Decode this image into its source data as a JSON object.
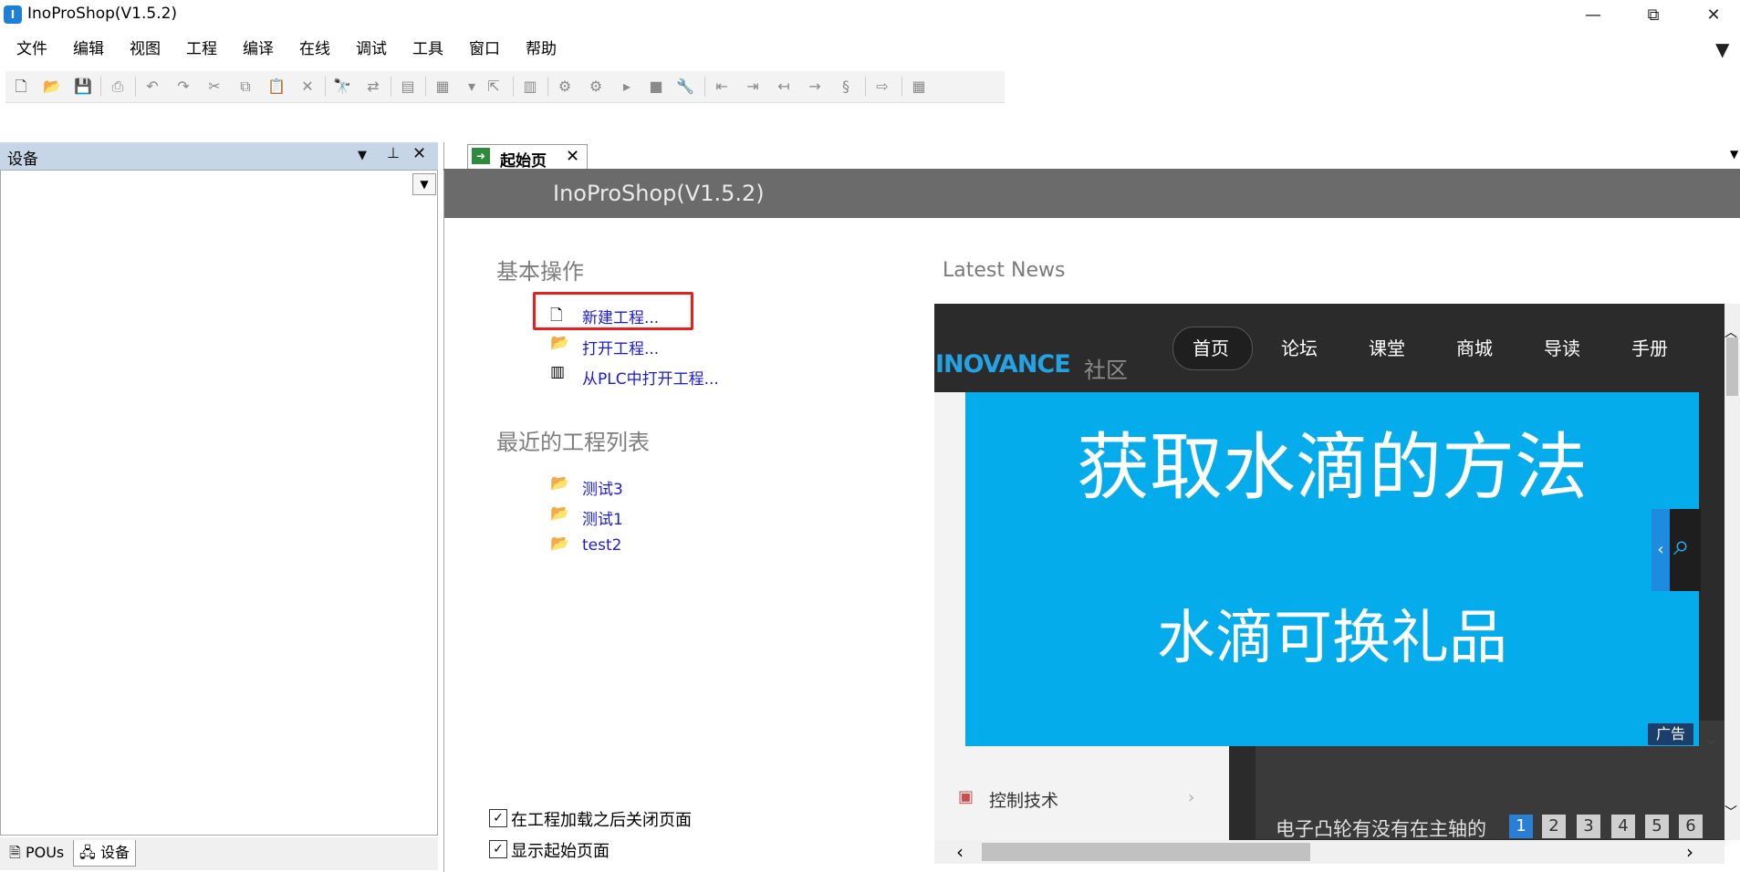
{
  "window": {
    "title": "InoProShop(V1.5.2)",
    "minimize_glyph": "—",
    "restore_glyph": "⧉",
    "close_glyph": "✕"
  },
  "menu": [
    "文件",
    "编辑",
    "视图",
    "工程",
    "编译",
    "在线",
    "调试",
    "工具",
    "窗口",
    "帮助"
  ],
  "left_panel": {
    "title": "设备",
    "tabs": [
      "POUs",
      "设备"
    ],
    "active_tab": "设备"
  },
  "doc_tab": {
    "label": "起始页"
  },
  "start_page": {
    "header_title": "InoProShop(V1.5.2)",
    "basic_ops_title": "基本操作",
    "actions": [
      "新建工程...",
      "打开工程...",
      "从PLC中打开工程..."
    ],
    "recent_title": "最近的工程列表",
    "recent": [
      "测试3",
      "测试1",
      "test2"
    ],
    "options": [
      {
        "label": "在工程加载之后关闭页面",
        "checked": true
      },
      {
        "label": "显示起始页面",
        "checked": true
      }
    ],
    "news_title": "Latest News"
  },
  "news": {
    "brand": "INOVANCE",
    "brand_suffix": "社区",
    "nav": [
      "首页",
      "论坛",
      "课堂",
      "商城",
      "导读",
      "手册"
    ],
    "active_nav": "首页",
    "ad_line1": "获取水滴的方法",
    "ad_line2": "水滴可换礼品",
    "ad_label": "广告",
    "side_item": "控制技术",
    "caption": "电子凸轮有没有在主轴的",
    "pages": [
      "1",
      "2",
      "3",
      "4",
      "5",
      "6"
    ],
    "active_page": "1"
  }
}
